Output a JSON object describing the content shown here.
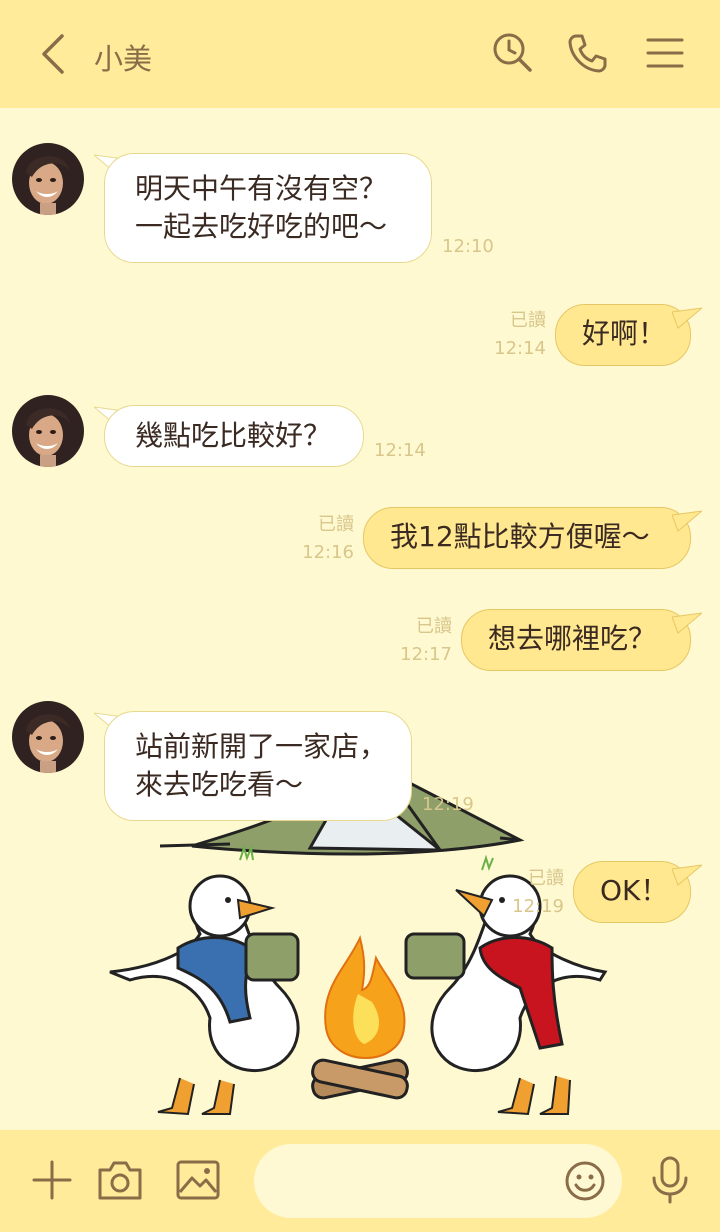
{
  "header": {
    "title": "小美"
  },
  "messages": [
    {
      "side": "in",
      "text": "明天中午有沒有空？\n一起去吃好吃的吧～",
      "time": "12:10"
    },
    {
      "side": "out",
      "text": "好啊！",
      "read": "已讀",
      "time": "12:14"
    },
    {
      "side": "in",
      "text": "幾點吃比較好？",
      "time": "12:14"
    },
    {
      "side": "out",
      "text": "我12點比較方便喔～",
      "read": "已讀",
      "time": "12:16"
    },
    {
      "side": "out",
      "text": "想去哪裡吃？",
      "read": "已讀",
      "time": "12:17"
    },
    {
      "side": "in",
      "text": "站前新開了一家店，\n來去吃吃看～",
      "time": "12:19"
    },
    {
      "side": "out",
      "text": "OK！",
      "read": "已讀",
      "time": "12:19"
    }
  ],
  "footer": {
    "input_placeholder": ""
  },
  "icons": [
    "back-icon",
    "search-clock-icon",
    "phone-icon",
    "menu-icon",
    "plus-icon",
    "camera-icon",
    "image-icon",
    "emoji-icon",
    "microphone-icon"
  ],
  "colors": {
    "header": "#ffeb9a",
    "background": "#fff9d1",
    "outgoing_bubble": "#ffe88f",
    "incoming_bubble": "#ffffff",
    "meta_text": "#d8c68b"
  }
}
